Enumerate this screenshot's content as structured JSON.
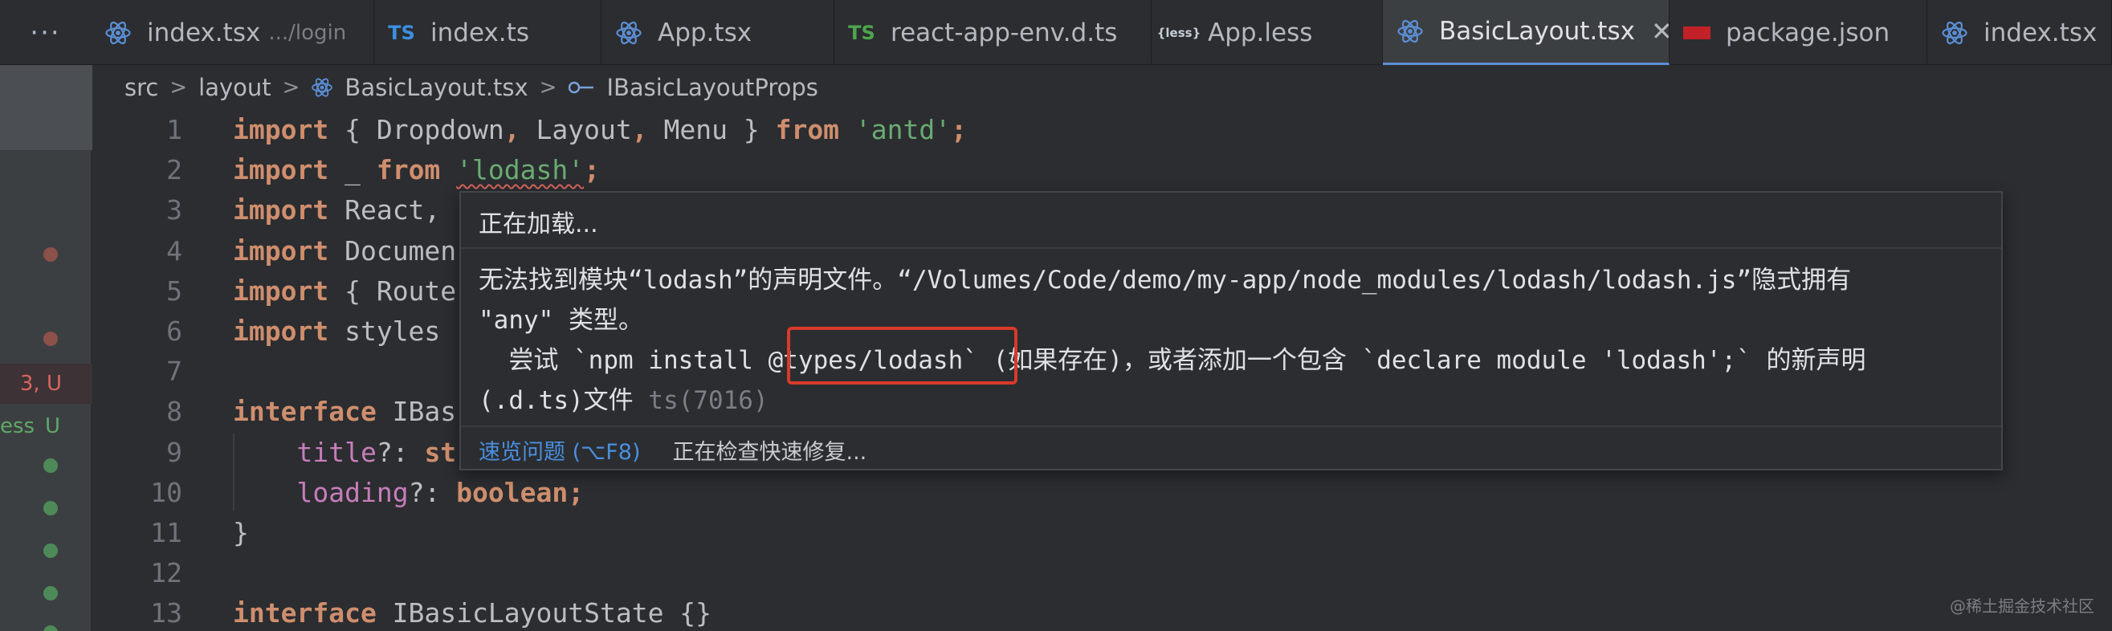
{
  "tabs": [
    {
      "name": "index.tsx",
      "desc": ".../login",
      "icon": "react-icon"
    },
    {
      "name": "index.ts",
      "desc": "",
      "icon": "typescript-icon"
    },
    {
      "name": "App.tsx",
      "desc": "",
      "icon": "react-icon"
    },
    {
      "name": "react-app-env.d.ts",
      "desc": "",
      "icon": "typescript-definition-icon"
    },
    {
      "name": "App.less",
      "desc": "",
      "icon": "less-icon"
    },
    {
      "name": "BasicLayout.tsx",
      "desc": "",
      "icon": "react-icon",
      "active": true
    },
    {
      "name": "package.json",
      "desc": "",
      "icon": "npm-icon"
    },
    {
      "name": "index.tsx",
      "desc": "",
      "icon": "react-icon"
    }
  ],
  "more_label": "···",
  "ts_label": "TS",
  "less_label": "{less}",
  "close_glyph": "✕",
  "breadcrumb": {
    "items": [
      "src",
      "layout",
      "BasicLayout.tsx",
      "IBasicLayoutProps"
    ],
    "separator": ">"
  },
  "gutter": {
    "error_count": "3, U",
    "git_name": "ess",
    "git_status": "U"
  },
  "editor": {
    "lines": [
      {
        "n": "1",
        "tokens": [
          [
            "kw",
            "import"
          ],
          [
            "pun",
            " { "
          ],
          [
            "cls",
            "Dropdown"
          ],
          [
            "kw",
            ","
          ],
          [
            "cls",
            " Layout"
          ],
          [
            "kw",
            ","
          ],
          [
            "cls",
            " Menu "
          ],
          [
            "pun",
            "} "
          ],
          [
            "kw",
            "from "
          ],
          [
            "str",
            "'antd'"
          ],
          [
            "kw",
            ";"
          ]
        ]
      },
      {
        "n": "2",
        "tokens": [
          [
            "kw",
            "import"
          ],
          [
            "pun",
            " _ "
          ],
          [
            "kw",
            "from "
          ],
          [
            "str sq",
            "'lodash'"
          ],
          [
            "kw",
            ";"
          ]
        ]
      },
      {
        "n": "3",
        "tokens": [
          [
            "kw",
            "import"
          ],
          [
            "pun",
            " React,"
          ]
        ]
      },
      {
        "n": "4",
        "tokens": [
          [
            "kw",
            "import"
          ],
          [
            "pun",
            " Documen"
          ]
        ]
      },
      {
        "n": "5",
        "tokens": [
          [
            "kw",
            "import"
          ],
          [
            "pun",
            " { Route"
          ]
        ]
      },
      {
        "n": "6",
        "tokens": [
          [
            "kw",
            "import"
          ],
          [
            "pun",
            " styles"
          ]
        ]
      },
      {
        "n": "7",
        "tokens": []
      },
      {
        "n": "8",
        "tokens": [
          [
            "kw",
            "interface"
          ],
          [
            "pun",
            " IBas"
          ]
        ]
      },
      {
        "n": "9",
        "tokens": [
          [
            "pun",
            "    "
          ],
          [
            "prop",
            "title"
          ],
          [
            "pun",
            "?: "
          ],
          [
            "kw",
            "st"
          ]
        ]
      },
      {
        "n": "10",
        "tokens": [
          [
            "pun",
            "    "
          ],
          [
            "prop",
            "loading"
          ],
          [
            "pun",
            "?: "
          ],
          [
            "kw",
            "boolean;"
          ]
        ]
      },
      {
        "n": "11",
        "tokens": [
          [
            "pun",
            "}"
          ]
        ]
      },
      {
        "n": "12",
        "tokens": []
      },
      {
        "n": "13",
        "tokens": [
          [
            "kw",
            "interface"
          ],
          [
            "pun",
            " IBasicLayoutState {}"
          ]
        ]
      }
    ]
  },
  "popup": {
    "loading": "正在加载...",
    "message_line1": "无法找到模块“lodash”的声明文件。“/Volumes/Code/demo/my-app/node_modules/lodash/lodash.js”隐式拥有",
    "message_line2": "\"any\" 类型。",
    "message_line3": "  尝试 `npm install @types/lodash` (如果存在)，或者添加一个包含 `declare module 'lodash';` 的新声明",
    "message_line4": "(.d.ts)文件 ",
    "error_code": "ts(7016)",
    "peek_link": "速览问题 (⌥F8)",
    "status": "正在检查快速修复..."
  },
  "watermark": "@稀土掘金技术社区"
}
